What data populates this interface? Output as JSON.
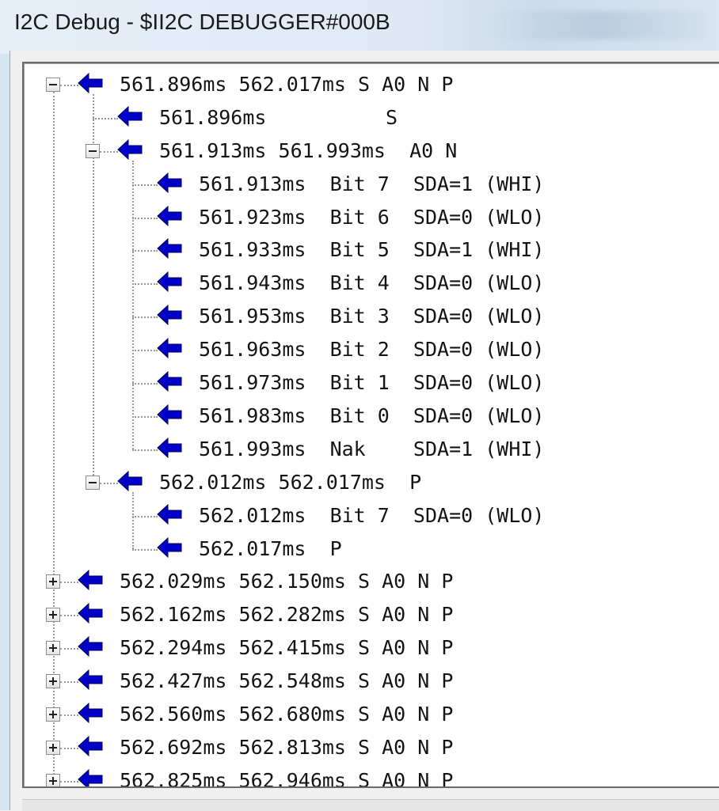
{
  "window": {
    "title": "I2C Debug - $II2C DEBUGGER#000B"
  },
  "colors": {
    "arrow": "#0000c8",
    "tree_background": "#ffffff",
    "text": "#141414"
  },
  "icons": {
    "row_icon": "left-arrow-icon",
    "expanded": "minus-box-icon",
    "collapsed": "plus-box-icon"
  },
  "tree": {
    "rows": [
      {
        "text": "561.896ms 562.017ms S A0 N P",
        "level": 0,
        "expander": "minus"
      },
      {
        "text": "561.896ms          S",
        "level": 1,
        "expander": "none"
      },
      {
        "text": "561.913ms 561.993ms  A0 N",
        "level": 1,
        "expander": "minus"
      },
      {
        "text": "561.913ms  Bit 7  SDA=1 (WHI)",
        "level": 2,
        "expander": "none"
      },
      {
        "text": "561.923ms  Bit 6  SDA=0 (WLO)",
        "level": 2,
        "expander": "none"
      },
      {
        "text": "561.933ms  Bit 5  SDA=1 (WHI)",
        "level": 2,
        "expander": "none"
      },
      {
        "text": "561.943ms  Bit 4  SDA=0 (WLO)",
        "level": 2,
        "expander": "none"
      },
      {
        "text": "561.953ms  Bit 3  SDA=0 (WLO)",
        "level": 2,
        "expander": "none"
      },
      {
        "text": "561.963ms  Bit 2  SDA=0 (WLO)",
        "level": 2,
        "expander": "none"
      },
      {
        "text": "561.973ms  Bit 1  SDA=0 (WLO)",
        "level": 2,
        "expander": "none"
      },
      {
        "text": "561.983ms  Bit 0  SDA=0 (WLO)",
        "level": 2,
        "expander": "none"
      },
      {
        "text": "561.993ms  Nak    SDA=1 (WHI)",
        "level": 2,
        "expander": "none"
      },
      {
        "text": "562.012ms 562.017ms  P",
        "level": 1,
        "expander": "minus"
      },
      {
        "text": "562.012ms  Bit 7  SDA=0 (WLO)",
        "level": 2,
        "expander": "none"
      },
      {
        "text": "562.017ms  P",
        "level": 2,
        "expander": "none"
      },
      {
        "text": "562.029ms 562.150ms S A0 N P",
        "level": 0,
        "expander": "plus"
      },
      {
        "text": "562.162ms 562.282ms S A0 N P",
        "level": 0,
        "expander": "plus"
      },
      {
        "text": "562.294ms 562.415ms S A0 N P",
        "level": 0,
        "expander": "plus"
      },
      {
        "text": "562.427ms 562.548ms S A0 N P",
        "level": 0,
        "expander": "plus"
      },
      {
        "text": "562.560ms 562.680ms S A0 N P",
        "level": 0,
        "expander": "plus"
      },
      {
        "text": "562.692ms 562.813ms S A0 N P",
        "level": 0,
        "expander": "plus"
      },
      {
        "text": "562.825ms 562.946ms S A0 N P",
        "level": 0,
        "expander": "plus"
      }
    ]
  }
}
